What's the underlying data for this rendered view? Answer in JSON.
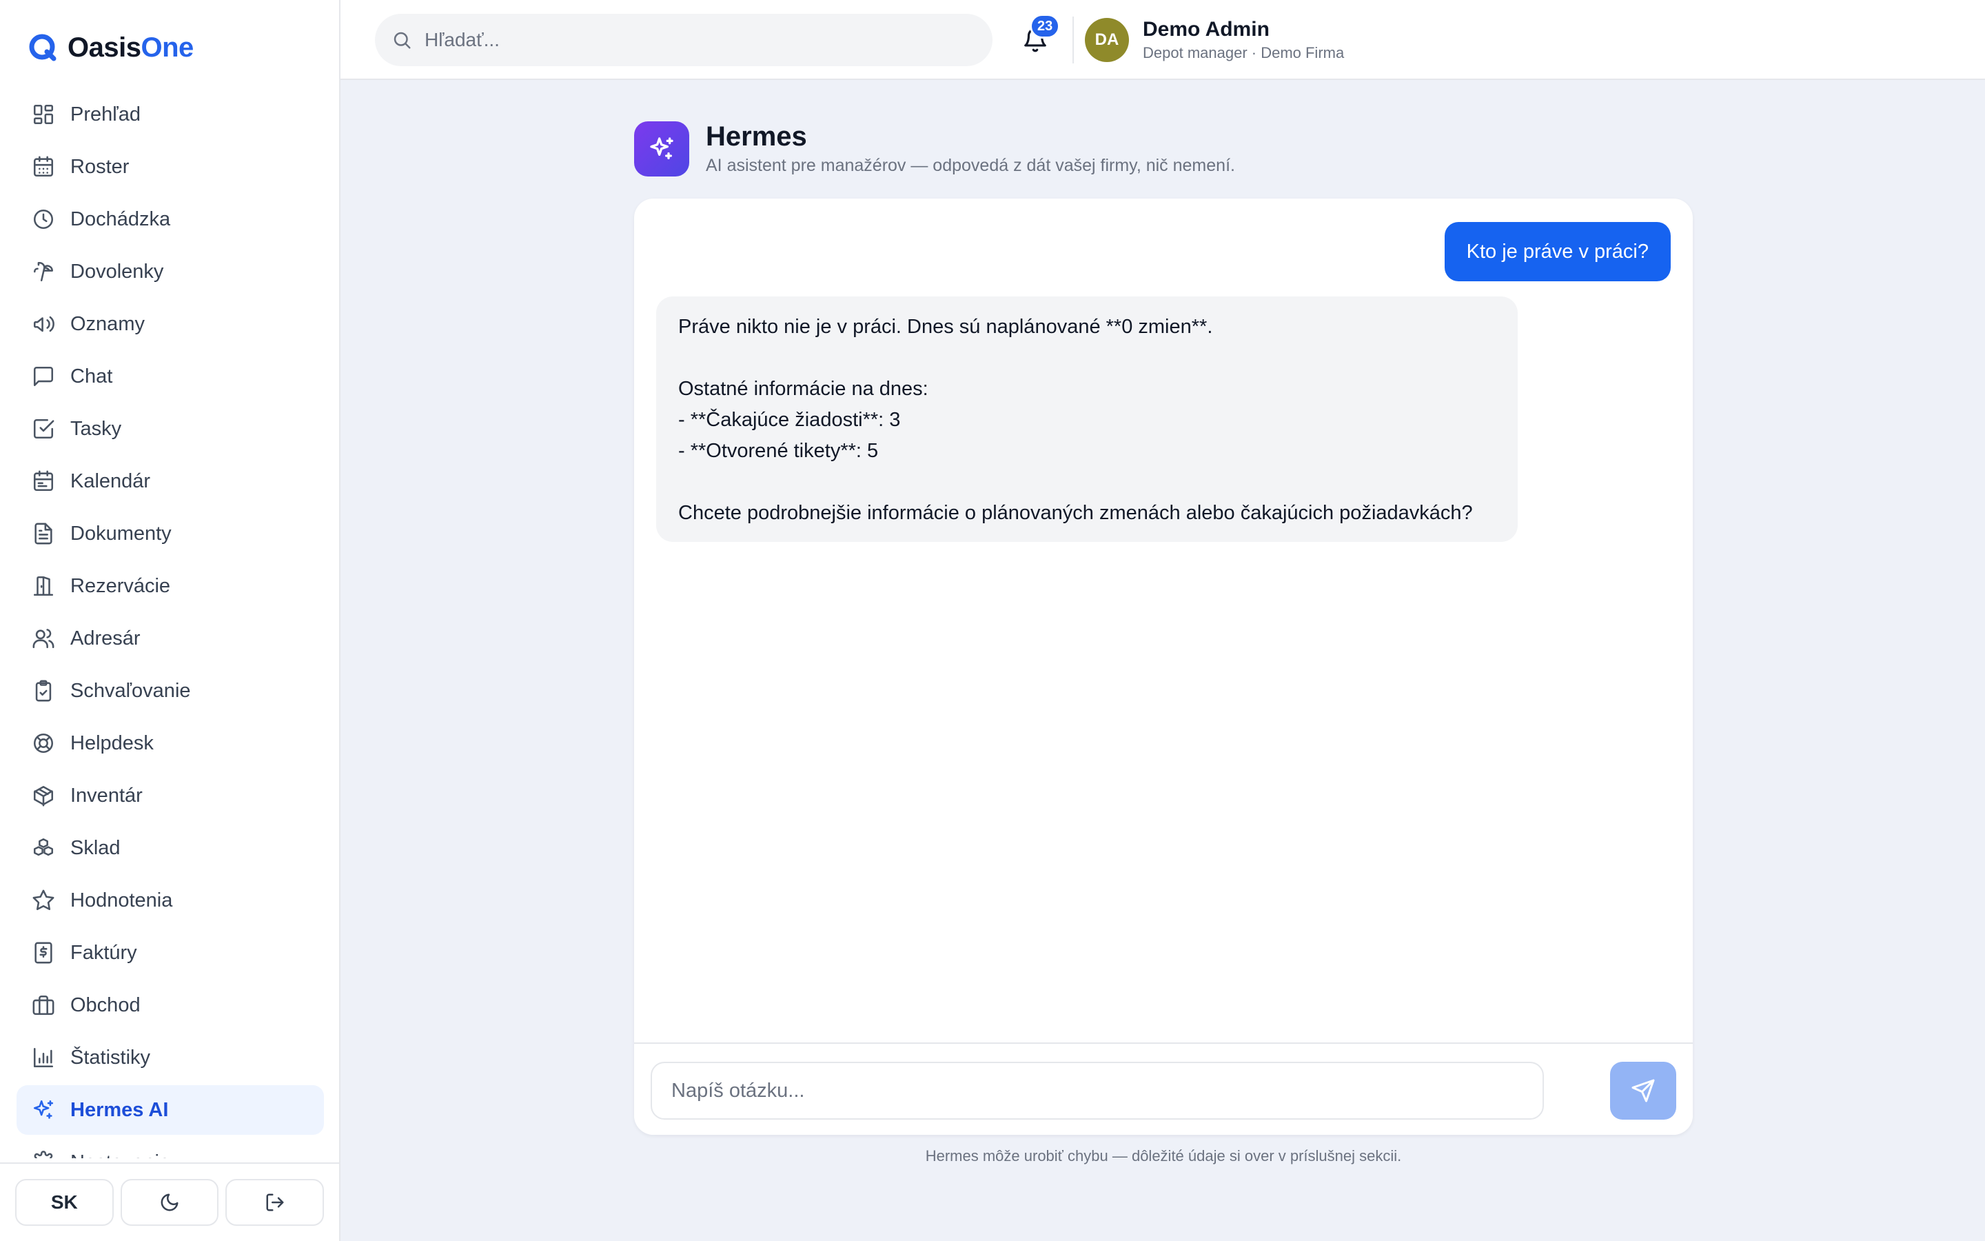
{
  "app": {
    "name_part1": "Oasis",
    "name_part2": "One",
    "accent_color": "#2563eb"
  },
  "sidebar": {
    "items": [
      {
        "label": "Prehľad",
        "icon": "dashboard-icon"
      },
      {
        "label": "Roster",
        "icon": "calendar-grid-icon"
      },
      {
        "label": "Dochádzka",
        "icon": "clock-icon"
      },
      {
        "label": "Dovolenky",
        "icon": "palm-tree-icon"
      },
      {
        "label": "Oznamy",
        "icon": "megaphone-icon"
      },
      {
        "label": "Chat",
        "icon": "chat-bubble-icon"
      },
      {
        "label": "Tasky",
        "icon": "checkbox-icon"
      },
      {
        "label": "Kalendár",
        "icon": "calendar-icon"
      },
      {
        "label": "Dokumenty",
        "icon": "document-icon"
      },
      {
        "label": "Rezervácie",
        "icon": "door-icon"
      },
      {
        "label": "Adresár",
        "icon": "users-icon"
      },
      {
        "label": "Schvaľovanie",
        "icon": "clipboard-check-icon"
      },
      {
        "label": "Helpdesk",
        "icon": "lifebuoy-icon"
      },
      {
        "label": "Inventár",
        "icon": "package-icon"
      },
      {
        "label": "Sklad",
        "icon": "boxes-icon"
      },
      {
        "label": "Hodnotenia",
        "icon": "star-icon"
      },
      {
        "label": "Faktúry",
        "icon": "invoice-icon"
      },
      {
        "label": "Obchod",
        "icon": "briefcase-icon"
      },
      {
        "label": "Štatistiky",
        "icon": "bar-chart-icon"
      },
      {
        "label": "Hermes AI",
        "icon": "sparkles-icon",
        "active": true
      },
      {
        "label": "Nastavenia",
        "icon": "gear-icon"
      }
    ],
    "footer": {
      "language": "SK",
      "theme_icon": "moon-icon",
      "logout_icon": "logout-icon"
    }
  },
  "topbar": {
    "search_placeholder": "Hľadať...",
    "notification_count": "23",
    "user": {
      "initials": "DA",
      "name": "Demo Admin",
      "role": "Depot manager · Demo Firma",
      "avatar_color": "#8f8a2a"
    }
  },
  "page": {
    "title": "Hermes",
    "subtitle": "AI asistent pre manažérov — odpovedá z dát vašej firmy, nič nemení."
  },
  "chat": {
    "user_message": "Kto je práve v práci?",
    "bot_message_lines": [
      "Práve nikto nie je v práci. Dnes sú naplánované **0 zmien**.",
      "",
      "Ostatné informácie na dnes:",
      "- **Čakajúce žiadosti**: 3",
      "- **Otvorené tikety**: 5",
      "",
      "Chcete podrobnejšie informácie o plánovaných zmenách alebo čakajúcich požiadavkách?"
    ],
    "input_placeholder": "Napíš otázku...",
    "disclaimer": "Hermes môže urobiť chybu — dôležité údaje si over v príslušnej sekcii."
  }
}
